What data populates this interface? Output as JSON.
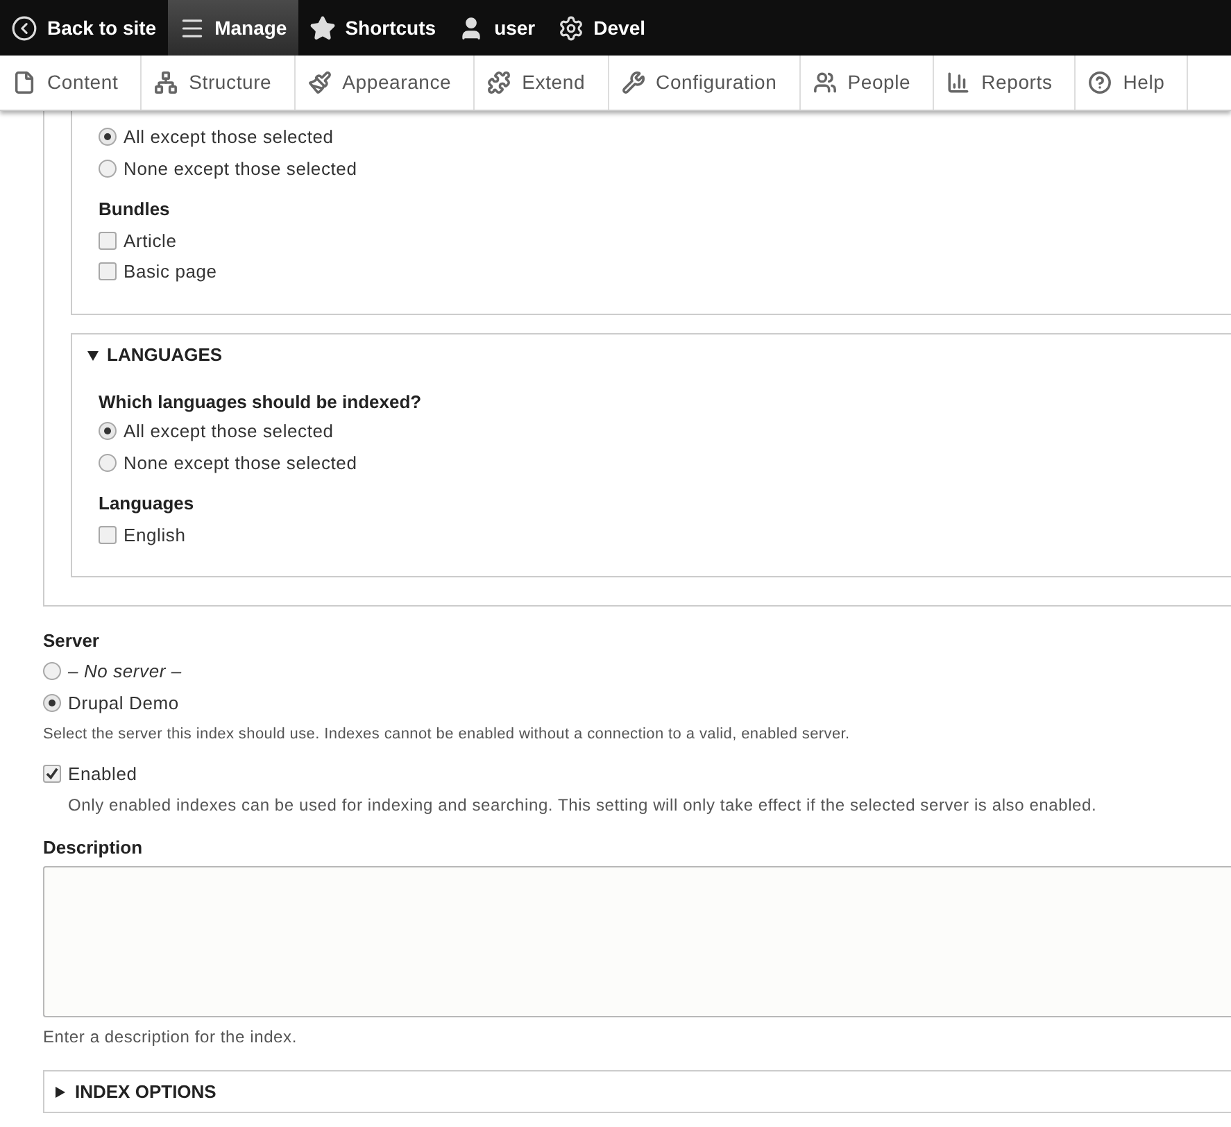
{
  "toolbar": {
    "items": [
      {
        "label": "Back to site",
        "selected": false
      },
      {
        "label": "Manage",
        "selected": true
      },
      {
        "label": "Shortcuts",
        "selected": false
      },
      {
        "label": "user",
        "selected": false
      },
      {
        "label": "Devel",
        "selected": false
      }
    ]
  },
  "tray": {
    "items": [
      {
        "label": "Content"
      },
      {
        "label": "Structure"
      },
      {
        "label": "Appearance"
      },
      {
        "label": "Extend"
      },
      {
        "label": "Configuration"
      },
      {
        "label": "People"
      },
      {
        "label": "Reports"
      },
      {
        "label": "Help"
      }
    ]
  },
  "bundles": {
    "radios": [
      {
        "label": "All except those selected",
        "selected": true
      },
      {
        "label": "None except those selected",
        "selected": false
      }
    ],
    "list_title": "Bundles",
    "items": [
      {
        "label": "Article",
        "checked": false
      },
      {
        "label": "Basic page",
        "checked": false
      }
    ]
  },
  "languages": {
    "title": "LANGUAGES",
    "expanded": true,
    "question": "Which languages should be indexed?",
    "radios": [
      {
        "label": "All except those selected",
        "selected": true
      },
      {
        "label": "None except those selected",
        "selected": false
      }
    ],
    "list_title": "Languages",
    "items": [
      {
        "label": "English",
        "checked": false
      }
    ]
  },
  "server": {
    "label": "Server",
    "options": [
      {
        "label": "– No server –",
        "kind": "none",
        "selected": false
      },
      {
        "label": "Drupal Demo",
        "kind": "server",
        "selected": true
      }
    ],
    "help": "Select the server this index should use. Indexes cannot be enabled without a connection to a valid, enabled server."
  },
  "enabled": {
    "label": "Enabled",
    "checked": true,
    "help": "Only enabled indexes can be used for indexing and searching. This setting will only take effect if the selected server is also enabled."
  },
  "description": {
    "label": "Description",
    "help": "Enter a description for the index."
  },
  "index_options": {
    "title": "INDEX OPTIONS",
    "expanded": false
  }
}
